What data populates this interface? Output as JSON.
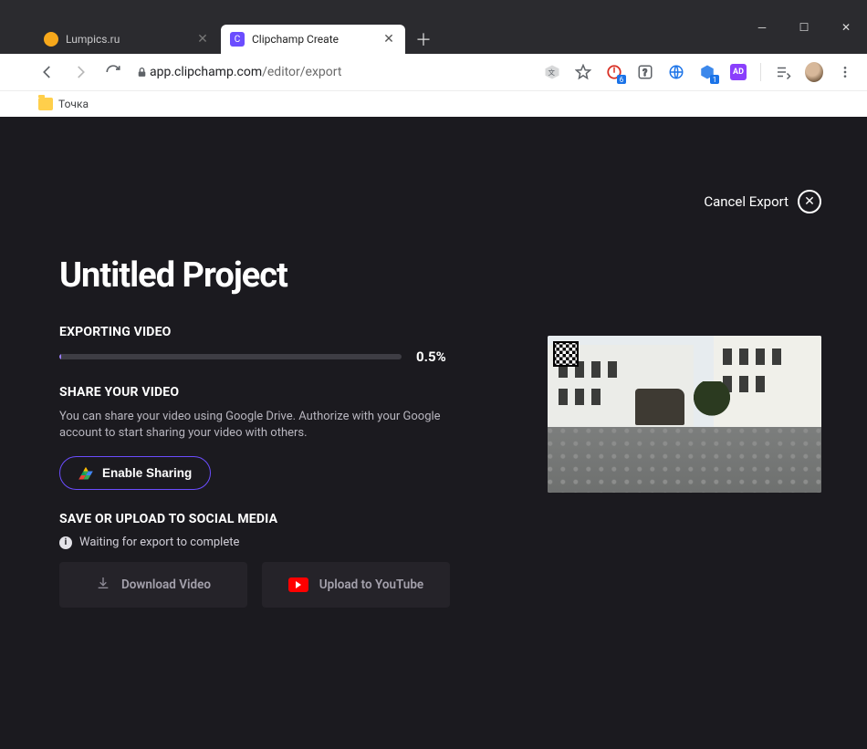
{
  "window": {
    "tabs": [
      {
        "title": "Lumpics.ru",
        "active": false
      },
      {
        "title": "Clipchamp Create",
        "active": true
      }
    ]
  },
  "address": {
    "host": "app.clipchamp.com",
    "path": "/editor/export"
  },
  "bookmarks": {
    "item1": "Точка"
  },
  "app": {
    "cancel_label": "Cancel Export",
    "project_title": "Untitled Project",
    "exporting_label": "EXPORTING VIDEO",
    "progress_pct": "0.5%",
    "progress_value": 0.5,
    "share_label": "SHARE YOUR VIDEO",
    "share_desc": "You can share your video using Google Drive. Authorize with your Google account to start sharing your video with others.",
    "enable_sharing": "Enable Sharing",
    "save_label": "SAVE OR UPLOAD TO SOCIAL MEDIA",
    "waiting_text": "Waiting for export to complete",
    "download_label": "Download Video",
    "upload_yt_label": "Upload to YouTube"
  }
}
